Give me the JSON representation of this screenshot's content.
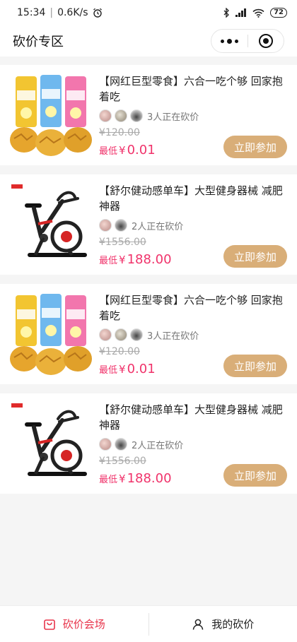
{
  "status": {
    "time": "15:34",
    "speed": "0.6K/s",
    "battery": "72"
  },
  "nav": {
    "title": "砍价专区"
  },
  "products": [
    {
      "title": "【网红巨型零食】六合一吃个够 回家抱着吃",
      "people": "3人正在砍价",
      "original": "¥120.00",
      "lowest_label": "最低",
      "currency": "¥",
      "lowest": "0.01",
      "button": "立即参加",
      "type": "snack"
    },
    {
      "title": "【舒尔健动感单车】大型健身器械 减肥神器",
      "people": "2人正在砍价",
      "original": "¥1556.00",
      "lowest_label": "最低",
      "currency": "¥",
      "lowest": "188.00",
      "button": "立即参加",
      "type": "bike"
    },
    {
      "title": "【网红巨型零食】六合一吃个够 回家抱着吃",
      "people": "3人正在砍价",
      "original": "¥120.00",
      "lowest_label": "最低",
      "currency": "¥",
      "lowest": "0.01",
      "button": "立即参加",
      "type": "snack"
    },
    {
      "title": "【舒尔健动感单车】大型健身器械 减肥神器",
      "people": "2人正在砍价",
      "original": "¥1556.00",
      "lowest_label": "最低",
      "currency": "¥",
      "lowest": "188.00",
      "button": "立即参加",
      "type": "bike"
    }
  ],
  "tabs": [
    {
      "label": "砍价会场",
      "icon": "bag-icon",
      "active": true
    },
    {
      "label": "我的砍价",
      "icon": "person-icon",
      "active": false
    }
  ],
  "colors": {
    "accent": "#d9ae78",
    "price": "#f0336b",
    "tab_active": "#e8334a"
  }
}
